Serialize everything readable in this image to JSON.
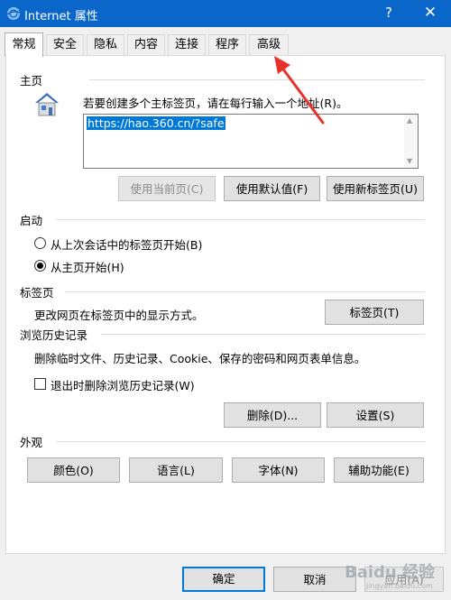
{
  "window": {
    "title": "Internet 属性",
    "help": "?",
    "close": "✕"
  },
  "tabs": [
    {
      "label": "常规",
      "active": true
    },
    {
      "label": "安全"
    },
    {
      "label": "隐私"
    },
    {
      "label": "内容"
    },
    {
      "label": "连接"
    },
    {
      "label": "程序"
    },
    {
      "label": "高级"
    }
  ],
  "home": {
    "section_title": "主页",
    "instruction": "若要创建多个主标签页，请在每行输入一个地址(R)。",
    "url_value": "https://hao.360.cn/?safe",
    "use_current": "使用当前页(C)",
    "use_default": "使用默认值(F)",
    "use_new_tab": "使用新标签页(U)"
  },
  "startup": {
    "section_title": "启动",
    "option_last_session": "从上次会话中的标签页开始(B)",
    "option_home": "从主页开始(H)",
    "selected": "option_home"
  },
  "tabs_section": {
    "section_title": "标签页",
    "description": "更改网页在标签页中的显示方式。",
    "button": "标签页(T)"
  },
  "history": {
    "section_title": "浏览历史记录",
    "description": "删除临时文件、历史记录、Cookie、保存的密码和网页表单信息。",
    "checkbox_label": "退出时删除浏览历史记录(W)",
    "checkbox_checked": false,
    "delete_button": "删除(D)...",
    "settings_button": "设置(S)"
  },
  "appearance": {
    "section_title": "外观",
    "colors": "颜色(O)",
    "languages": "语言(L)",
    "fonts": "字体(N)",
    "accessibility": "辅助功能(E)"
  },
  "footer": {
    "ok": "确定",
    "cancel": "取消",
    "apply": "应用(A)"
  },
  "watermark": {
    "text": "Baidu 经验",
    "sub": "jingyan.baidu.com"
  },
  "colors": {
    "titlebar": "#0a66c8",
    "selection": "#0078d7",
    "annotation_arrow": "#e8312a"
  }
}
